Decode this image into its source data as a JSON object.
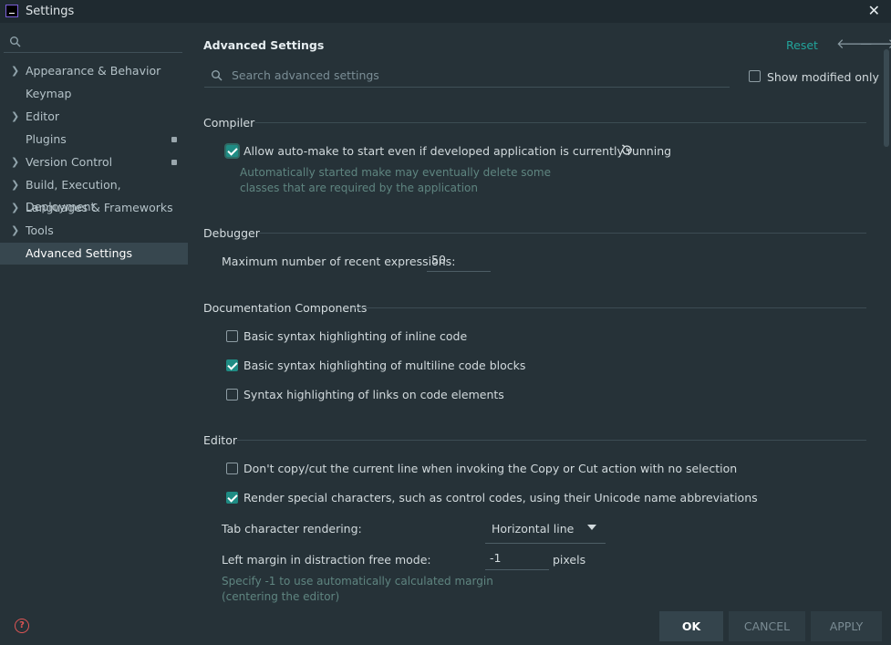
{
  "window": {
    "title": "Settings"
  },
  "sidebar": {
    "search_placeholder": "",
    "items": [
      {
        "label": "Appearance & Behavior",
        "expandable": true,
        "locked": false
      },
      {
        "label": "Keymap",
        "expandable": false,
        "locked": false
      },
      {
        "label": "Editor",
        "expandable": true,
        "locked": false
      },
      {
        "label": "Plugins",
        "expandable": false,
        "locked": true
      },
      {
        "label": "Version Control",
        "expandable": true,
        "locked": true
      },
      {
        "label": "Build, Execution, Deployment",
        "expandable": true,
        "locked": false
      },
      {
        "label": "Languages & Frameworks",
        "expandable": true,
        "locked": false
      },
      {
        "label": "Tools",
        "expandable": true,
        "locked": false
      },
      {
        "label": "Advanced Settings",
        "expandable": false,
        "locked": false,
        "selected": true
      }
    ]
  },
  "header": {
    "title": "Advanced Settings",
    "reset_label": "Reset",
    "back_icon": "arrow-left-icon",
    "forward_icon": "arrow-right-icon"
  },
  "search": {
    "placeholder": "Search advanced settings",
    "value": "",
    "show_modified_label": "Show modified only",
    "show_modified_checked": false
  },
  "sections": {
    "compiler": {
      "title": "Compiler",
      "automake_label": "Allow auto-make to start even if developed application is currently running",
      "automake_checked": true,
      "automake_hint": "Automatically started make may eventually delete some classes that are required by the application"
    },
    "debugger": {
      "title": "Debugger",
      "recent_expr_label": "Maximum number of recent expressions:",
      "recent_expr_value": "50"
    },
    "docs": {
      "title": "Documentation Components",
      "options": [
        {
          "label": "Basic syntax highlighting of inline code",
          "checked": false
        },
        {
          "label": "Basic syntax highlighting of multiline code blocks",
          "checked": true
        },
        {
          "label": "Syntax highlighting of links on code elements",
          "checked": false
        }
      ]
    },
    "editor": {
      "title": "Editor",
      "options": [
        {
          "label": "Don't copy/cut the current line when invoking the Copy or Cut action with no selection",
          "checked": false
        },
        {
          "label": "Render special characters, such as control codes, using their Unicode name abbreviations",
          "checked": true
        }
      ],
      "tab_render_label": "Tab character rendering:",
      "tab_render_value": "Horizontal line",
      "left_margin_label": "Left margin in distraction free mode:",
      "left_margin_value": "-1",
      "left_margin_unit": "pixels",
      "left_margin_hint": "Specify -1 to use automatically calculated margin (centering the editor)"
    }
  },
  "footer": {
    "ok_label": "OK",
    "cancel_label": "CANCEL",
    "apply_label": "APPLY"
  },
  "colors": {
    "accent": "#22a39a",
    "background": "#263238",
    "selection": "#37474f"
  }
}
